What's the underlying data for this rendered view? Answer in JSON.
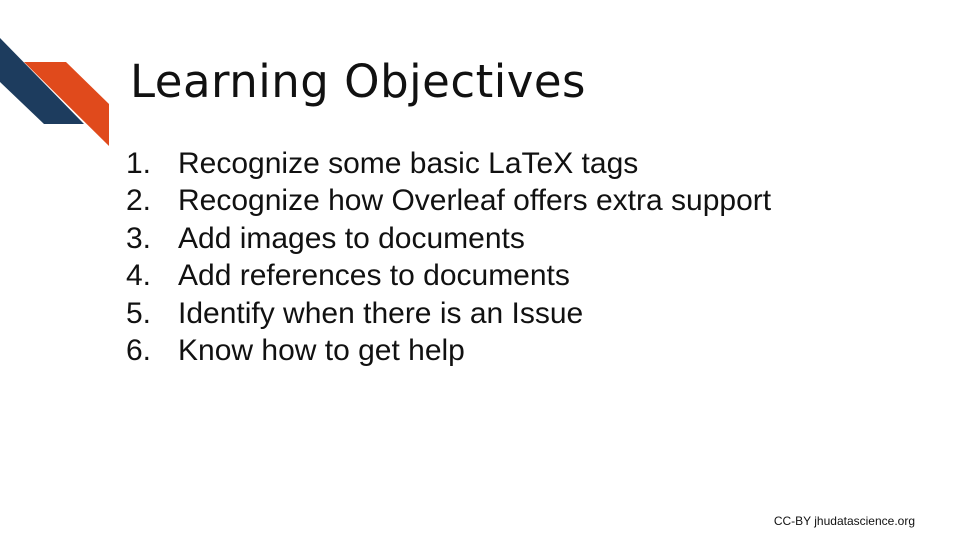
{
  "slide": {
    "title": "Learning Objectives",
    "objectives": [
      {
        "number": "1.",
        "text": "Recognize some basic LaTeX tags"
      },
      {
        "number": "2.",
        "text": "Recognize how Overleaf offers extra support"
      },
      {
        "number": "3.",
        "text": "Add images to documents"
      },
      {
        "number": "4.",
        "text": "Add references to documents"
      },
      {
        "number": "5.",
        "text": "Identify when there is an Issue"
      },
      {
        "number": "6.",
        "text": "Know how to get help"
      }
    ],
    "footer": "CC-BY jhudatascience.org"
  },
  "colors": {
    "stripe_blue": "#1d3c5e",
    "stripe_orange": "#e04a1c",
    "text": "#111111",
    "background": "#ffffff"
  },
  "icons": {
    "corner": "diagonal-stripes-decoration"
  }
}
